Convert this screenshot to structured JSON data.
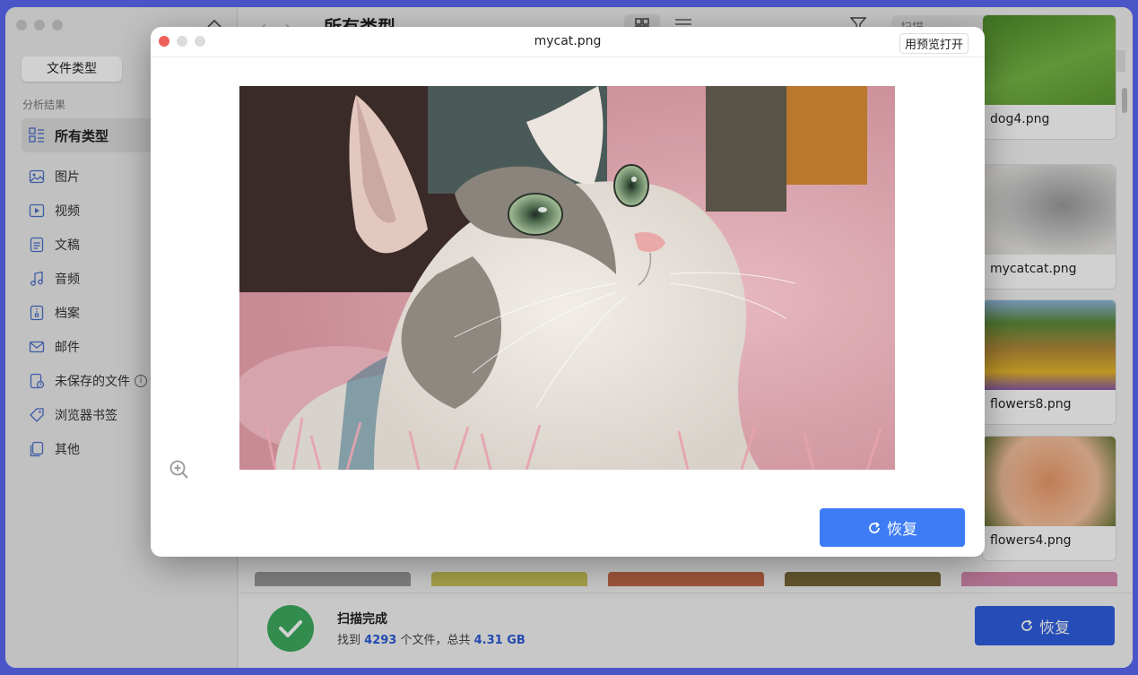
{
  "sidebar": {
    "tab_label": "文件类型",
    "section_label": "分析结果",
    "items": [
      {
        "label": "所有类型",
        "icon": "all-types-icon"
      },
      {
        "label": "图片",
        "icon": "image-icon"
      },
      {
        "label": "视频",
        "icon": "video-icon"
      },
      {
        "label": "文稿",
        "icon": "document-icon"
      },
      {
        "label": "音频",
        "icon": "music-icon"
      },
      {
        "label": "档案",
        "icon": "archive-icon"
      },
      {
        "label": "邮件",
        "icon": "mail-icon"
      },
      {
        "label": "未保存的文件",
        "icon": "unsaved-file-icon"
      },
      {
        "label": "浏览器书签",
        "icon": "bookmark-icon"
      },
      {
        "label": "其他",
        "icon": "other-icon"
      }
    ]
  },
  "toolbar": {
    "title": "所有类型",
    "search_placeholder": "扫描"
  },
  "grid": {
    "cards": [
      {
        "name": "dog4.png"
      },
      {
        "name": "mycatcat.png"
      },
      {
        "name": "flowers8.png"
      },
      {
        "name": "flowers4.png"
      }
    ]
  },
  "status": {
    "title": "扫描完成",
    "prefix": "找到",
    "count": "4293",
    "middle": "个文件，总共",
    "size": "4.31 GB",
    "recover_label": "恢复"
  },
  "modal": {
    "title": "mycat.png",
    "open_preview": "用预览打开",
    "recover_label": "恢复"
  },
  "colors": {
    "accent": "#2f5fe0",
    "modal_button": "#3d7cf5",
    "success": "#3cab5e"
  }
}
